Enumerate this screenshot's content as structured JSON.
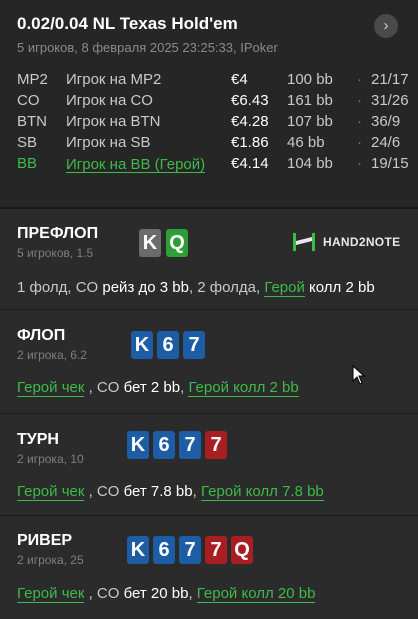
{
  "header": {
    "title": "0.02/0.04 NL Texas Hold'em",
    "subtitle": "5 игроков, 8 февраля 2025 23:25:33, IPoker",
    "nav_icon": "chevron-right-icon",
    "nav_glyph": "›"
  },
  "players": [
    {
      "pos": "MP2",
      "name": "Игрок на MP2",
      "stack": "€4",
      "bb": "100 bb",
      "sep": "·",
      "ratio": "21/17",
      "hero": false
    },
    {
      "pos": "CO",
      "name": "Игрок на CO",
      "stack": "€6.43",
      "bb": "161 bb",
      "sep": "·",
      "ratio": "31/26",
      "hero": false
    },
    {
      "pos": "BTN",
      "name": "Игрок на BTN",
      "stack": "€4.28",
      "bb": "107 bb",
      "sep": "·",
      "ratio": "36/9",
      "hero": false
    },
    {
      "pos": "SB",
      "name": "Игрок на SB",
      "stack": "€1.86",
      "bb": "46 bb",
      "sep": "·",
      "ratio": "24/6",
      "hero": false
    },
    {
      "pos": "BB",
      "name": "Игрок на BB (Герой)",
      "stack": "€4.14",
      "bb": "104 bb",
      "sep": "·",
      "ratio": "19/15",
      "hero": true
    }
  ],
  "colors": {
    "hero_green": "#3dbb48",
    "suit_spade": "#6b6b6b",
    "suit_club": "#2e9e36",
    "suit_diamond": "#1c5da6",
    "suit_heart": "#a81e22"
  },
  "logo": {
    "text": "HAND2NOTE",
    "icon": "hand2note-logo-icon"
  },
  "streets": {
    "preflop": {
      "title": "ПРЕФЛОП",
      "sub": "5 игроков, 1.5",
      "cards": [
        {
          "rank": "K",
          "suit": "s"
        },
        {
          "rank": "Q",
          "suit": "c"
        }
      ],
      "actions": {
        "a1": "1 фолд, CO ",
        "a2": "рейз до 3 bb",
        "a3": ", 2 фолда, ",
        "a4": "Герой",
        "a5": " ",
        "a6": "колл 2 bb"
      }
    },
    "flop": {
      "title": "ФЛОП",
      "sub": "2 игрока, 6.2",
      "cards": [
        {
          "rank": "K",
          "suit": "d"
        },
        {
          "rank": "6",
          "suit": "d"
        },
        {
          "rank": "7",
          "suit": "d"
        }
      ],
      "actions": {
        "a1": "Герой",
        "a2": " чек",
        "a3": " , CO ",
        "a4": "бет 2 bb",
        "a5": ", ",
        "a6": "Герой",
        "a7": " колл 2 bb"
      }
    },
    "turn": {
      "title": "ТУРН",
      "sub": "2 игрока, 10",
      "cards": [
        {
          "rank": "K",
          "suit": "d"
        },
        {
          "rank": "6",
          "suit": "d"
        },
        {
          "rank": "7",
          "suit": "d"
        },
        {
          "rank": "7",
          "suit": "h"
        }
      ],
      "actions": {
        "a1": "Герой",
        "a2": " чек",
        "a3": " , CO ",
        "a4": "бет 7.8 bb",
        "a5": ", ",
        "a6": "Герой",
        "a7": " колл 7.8 bb"
      }
    },
    "river": {
      "title": "РИВЕР",
      "sub": "2 игрока, 25",
      "cards": [
        {
          "rank": "K",
          "suit": "d"
        },
        {
          "rank": "6",
          "suit": "d"
        },
        {
          "rank": "7",
          "suit": "d"
        },
        {
          "rank": "7",
          "suit": "h"
        },
        {
          "rank": "Q",
          "suit": "h"
        }
      ],
      "actions": {
        "a1": "Герой",
        "a2": " чек",
        "a3": " , CO ",
        "a4": "бет 20 bb",
        "a5": ", ",
        "a6": "Герой",
        "a7": " колл 20 bb"
      }
    }
  }
}
